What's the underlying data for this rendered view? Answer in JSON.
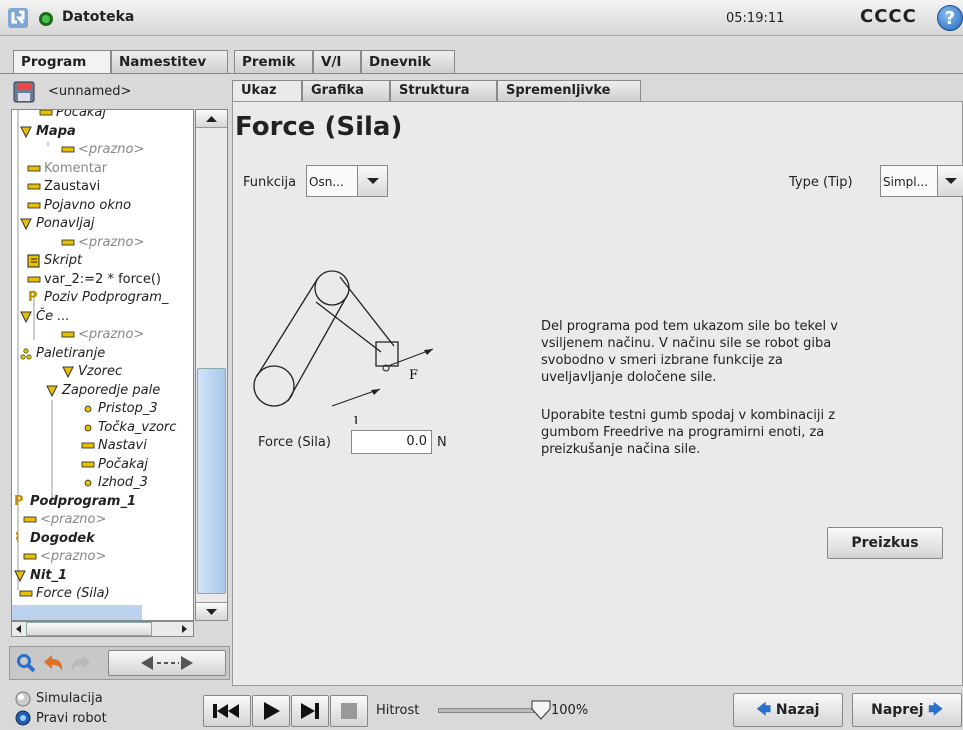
{
  "header": {
    "app_title": "Datoteka",
    "clock": "05:19:11",
    "robot_name": "CCCC",
    "help": "?"
  },
  "main_tabs": [
    "Program",
    "Namestitev",
    "Premik",
    "V/I",
    "Dnevnik"
  ],
  "file": {
    "name": "<unnamed>"
  },
  "sub_tabs": [
    "Ukaz",
    "Grafika",
    "Struktura",
    "Spremenljivke"
  ],
  "tree": [
    {
      "label": "Počakaj",
      "style": "it",
      "icon": "bar"
    },
    {
      "label": "Mapa",
      "style": "b it",
      "icon": "tri"
    },
    {
      "label": "<prazno>",
      "style": "it gray",
      "icon": "bar"
    },
    {
      "label": "Komentar",
      "style": "gray",
      "icon": "bar"
    },
    {
      "label": "Zaustavi",
      "style": "",
      "icon": "bar"
    },
    {
      "label": "Pojavno okno",
      "style": "it",
      "icon": "bar"
    },
    {
      "label": "Ponavljaj",
      "style": "it",
      "icon": "tri"
    },
    {
      "label": "<prazno>",
      "style": "it gray",
      "icon": "bar"
    },
    {
      "label": "Skript",
      "style": "it",
      "icon": "script"
    },
    {
      "label": "var_2:=2 * force()",
      "style": "",
      "icon": "bar"
    },
    {
      "label": "Poziv Podprogram_",
      "style": "it",
      "icon": "P"
    },
    {
      "label": "Če ...",
      "style": "it",
      "icon": "tri"
    },
    {
      "label": "<prazno>",
      "style": "it gray",
      "icon": "bar"
    },
    {
      "label": "Paletiranje",
      "style": "it",
      "icon": "pal"
    },
    {
      "label": "Vzorec",
      "style": "it",
      "icon": "tri"
    },
    {
      "label": "Zaporedje pale",
      "style": "it",
      "icon": "tri"
    },
    {
      "label": "Pristop_3",
      "style": "it",
      "icon": "dot"
    },
    {
      "label": "Točka_vzorc",
      "style": "it",
      "icon": "dot"
    },
    {
      "label": "Nastavi",
      "style": "it",
      "icon": "bar"
    },
    {
      "label": "Počakaj",
      "style": "it",
      "icon": "bar"
    },
    {
      "label": "Izhod_3",
      "style": "it",
      "icon": "dot"
    },
    {
      "label": "Podprogram_1",
      "style": "b it",
      "icon": "P"
    },
    {
      "label": "<prazno>",
      "style": "it gray",
      "icon": "bar"
    },
    {
      "label": "Dogodek",
      "style": "b it",
      "icon": "ev"
    },
    {
      "label": "<prazno>",
      "style": "it gray",
      "icon": "bar"
    },
    {
      "label": "Nit_1",
      "style": "b it",
      "icon": "tri"
    },
    {
      "label": "Force (Sila)",
      "style": "it",
      "icon": "bar"
    }
  ],
  "panel": {
    "title": "Force (Sila)",
    "funkcija_label": "Funkcija",
    "funkcija_value": "Osn...",
    "type_label": "Type (Tip)",
    "type_value": "Simpl...",
    "force_label": "Force (Sila)",
    "force_value": "0.0",
    "force_unit": "N",
    "desc1": [
      "Del programa pod tem ukazom sile bo tekel v",
      "vsiljenem načinu. V načinu sile se robot giba",
      "svobodno v smeri izbrane funkcije za",
      "uveljavljanje določene sile."
    ],
    "desc2": [
      "Uporabite testni gumb spodaj v kombinaciji z",
      "gumbom Freedrive na programirni enoti, za",
      "preizkušanje načina sile."
    ],
    "test_button": "Preizkus",
    "diagram_labels": {
      "force": "F",
      "dir": "l"
    }
  },
  "footer": {
    "simulation": "Simulacija",
    "real_robot": "Pravi robot",
    "speed_label": "Hitrost",
    "speed_value": "100%",
    "back": "Nazaj",
    "next": "Naprej"
  },
  "colors": {
    "selection": "#bcd3ee",
    "accent_blue": "#2a6fc9",
    "bar_yellow": "#e8c000"
  }
}
